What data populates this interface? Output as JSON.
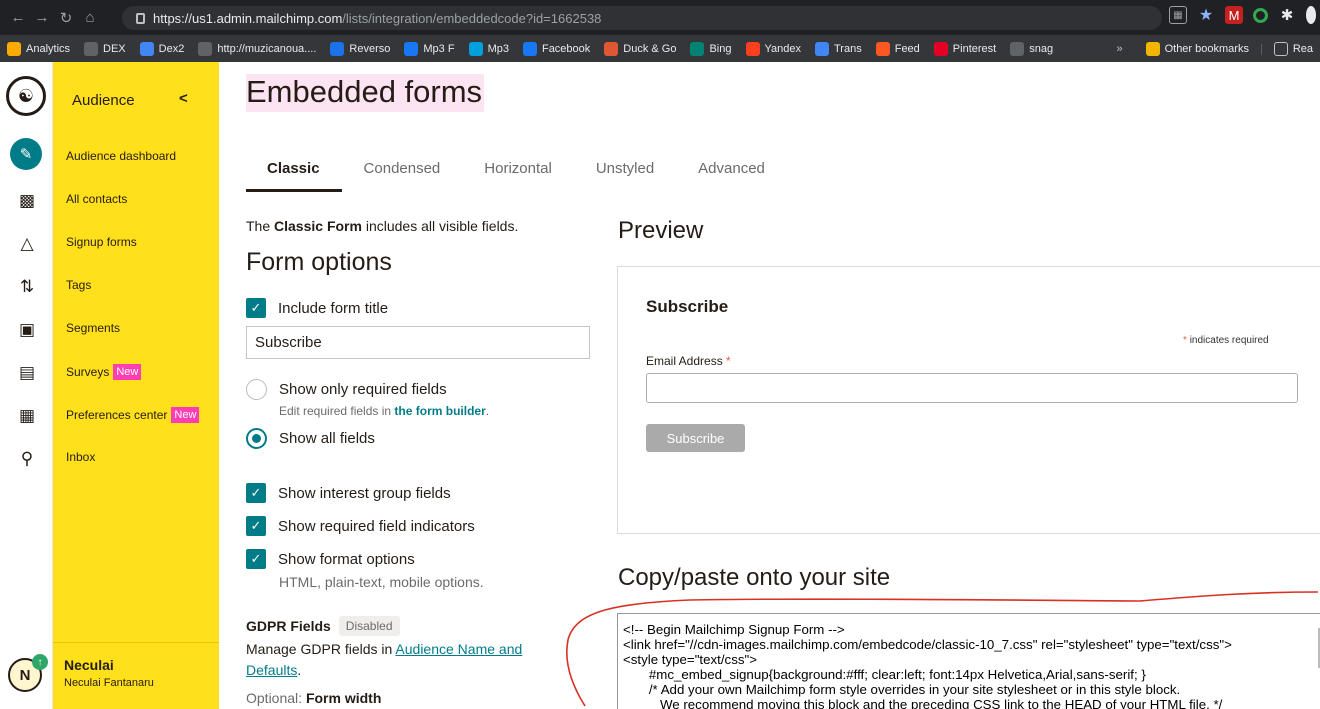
{
  "browser": {
    "url_host": "https://us1.admin.mailchimp.com",
    "url_path": "/lists/integration/embeddedcode?id=1662538",
    "bookmarks": [
      {
        "label": "Analytics",
        "icon": "analytics-icon",
        "color": "#f9ab00"
      },
      {
        "label": "DEX",
        "icon": "dex-icon",
        "color": "#5f6368"
      },
      {
        "label": "Dex2",
        "icon": "dex2-icon",
        "color": "#4285f4"
      },
      {
        "label": "http://muzicanoua....",
        "icon": "globe-icon",
        "color": "#5f6368"
      },
      {
        "label": "Reverso",
        "icon": "reverso-icon",
        "color": "#1a73e8"
      },
      {
        "label": "Mp3 F",
        "icon": "fb-icon",
        "color": "#1877f2"
      },
      {
        "label": "Mp3",
        "icon": "mp3-icon",
        "color": "#00a0dc"
      },
      {
        "label": "Facebook",
        "icon": "facebook-icon",
        "color": "#1877f2"
      },
      {
        "label": "Duck & Go",
        "icon": "duckduckgo-icon",
        "color": "#de5833"
      },
      {
        "label": "Bing",
        "icon": "bing-icon",
        "color": "#008373"
      },
      {
        "label": "Yandex",
        "icon": "yandex-icon",
        "color": "#fc3f1d"
      },
      {
        "label": "Trans",
        "icon": "translate-icon",
        "color": "#4285f4"
      },
      {
        "label": "Feed",
        "icon": "feed-icon",
        "color": "#ff5722"
      },
      {
        "label": "Pinterest",
        "icon": "pinterest-icon",
        "color": "#e60023"
      },
      {
        "label": "snag",
        "icon": "snag-icon",
        "color": "#5f6368"
      }
    ],
    "bm_overflow": "»",
    "other_bookmarks": "Other bookmarks",
    "reading_list": "Rea"
  },
  "rail": {
    "avatar_initial": "N"
  },
  "sidebar": {
    "title": "Audience",
    "collapse": "<",
    "items": [
      {
        "label": "Audience dashboard",
        "badge": ""
      },
      {
        "label": "All contacts",
        "badge": ""
      },
      {
        "label": "Signup forms",
        "badge": ""
      },
      {
        "label": "Tags",
        "badge": ""
      },
      {
        "label": "Segments",
        "badge": ""
      },
      {
        "label": "Surveys",
        "badge": "New"
      },
      {
        "label": "Preferences center",
        "badge": "New"
      },
      {
        "label": "Inbox",
        "badge": ""
      }
    ],
    "user_name": "Neculai",
    "user_full": "Neculai Fantanaru"
  },
  "main": {
    "page_title": "Embedded forms",
    "tabs": [
      "Classic",
      "Condensed",
      "Horizontal",
      "Unstyled",
      "Advanced"
    ],
    "intro_prefix": "The ",
    "intro_bold": "Classic Form",
    "intro_suffix": " includes all visible fields.",
    "options_heading": "Form options",
    "include_title_label": "Include form title",
    "form_title_value": "Subscribe",
    "radio_required_label": "Show only required fields",
    "radio_required_hint": "Edit required fields in ",
    "radio_required_link": "the form builder",
    "radio_required_end": ".",
    "radio_all_label": "Show all fields",
    "cb_interest": "Show interest group fields",
    "cb_indicators": "Show required field indicators",
    "cb_format": "Show format options",
    "cb_format_hint": "HTML, plain-text, mobile options.",
    "gdpr_label": "GDPR Fields",
    "gdpr_status": "Disabled",
    "gdpr_desc_prefix": "Manage GDPR fields in ",
    "gdpr_desc_link": "Audience Name and Defaults",
    "gdpr_desc_end": ".",
    "form_width_prefix": "Optional: ",
    "form_width_bold": "Form width"
  },
  "preview": {
    "heading": "Preview",
    "form_title": "Subscribe",
    "required_note": "indicates required",
    "star": "*",
    "email_label": "Email Address",
    "button": "Subscribe"
  },
  "copy": {
    "heading": "Copy/paste onto your site",
    "code": "<!-- Begin Mailchimp Signup Form -->\n<link href=\"//cdn-images.mailchimp.com/embedcode/classic-10_7.css\" rel=\"stylesheet\" type=\"text/css\">\n<style type=\"text/css\">\n       #mc_embed_signup{background:#fff; clear:left; font:14px Helvetica,Arial,sans-serif; }\n       /* Add your own Mailchimp form style overrides in your site stylesheet or in this style block.\n          We recommend moving this block and the preceding CSS link to the HEAD of your HTML file. */"
  },
  "colors": {
    "accent": "#007c89",
    "sidebar": "#ffe01b",
    "badge": "#ff3eb5",
    "annotation": "#d93025"
  }
}
